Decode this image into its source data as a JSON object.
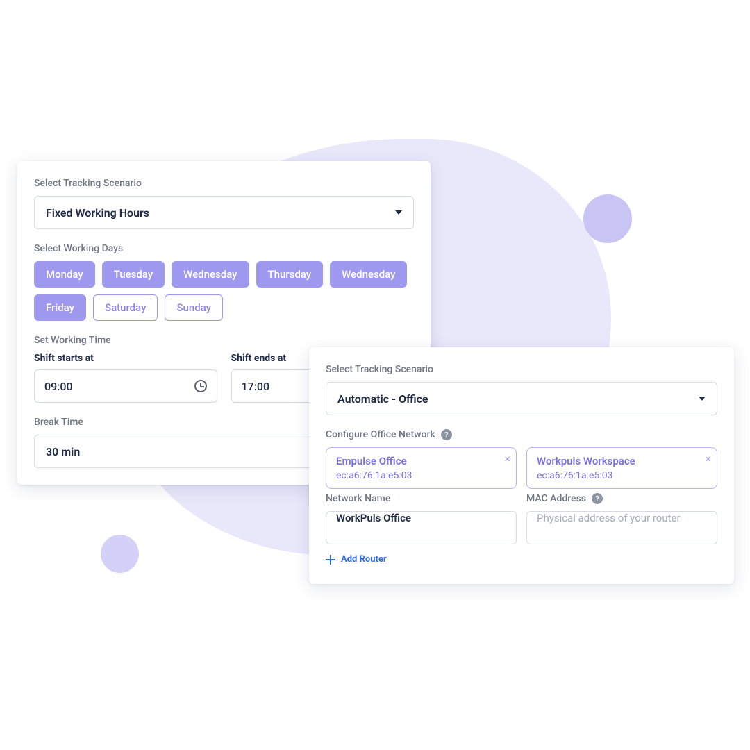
{
  "card1": {
    "scenario_label": "Select Tracking Scenario",
    "scenario_value": "Fixed Working Hours",
    "days_label": "Select Working Days",
    "days": [
      {
        "label": "Monday",
        "selected": true
      },
      {
        "label": "Tuesday",
        "selected": true
      },
      {
        "label": "Wednesday",
        "selected": true
      },
      {
        "label": "Thursday",
        "selected": true
      },
      {
        "label": "Wednesday",
        "selected": true
      },
      {
        "label": "Friday",
        "selected": true
      },
      {
        "label": "Saturday",
        "selected": false
      },
      {
        "label": "Sunday",
        "selected": false
      }
    ],
    "working_time_label": "Set Working Time",
    "shift_start_label": "Shift starts at",
    "shift_start_value": "09:00",
    "shift_end_label": "Shift ends at",
    "shift_end_value": "17:00",
    "break_label": "Break Time",
    "break_value": "30 min"
  },
  "card2": {
    "scenario_label": "Select Tracking Scenario",
    "scenario_value": "Automatic - Office",
    "network_label": "Configure Office Network",
    "networks": [
      {
        "name": "Empulse Office",
        "mac": "ec:a6:76:1a:e5:03"
      },
      {
        "name": "Workpuls Workspace",
        "mac": "ec:a6:76:1a:e5:03"
      }
    ],
    "network_name_label": "Network Name",
    "network_name_value": "WorkPuls Office",
    "mac_label": "MAC Address",
    "mac_placeholder": "Physical address of your router",
    "add_router_label": "Add Router"
  }
}
